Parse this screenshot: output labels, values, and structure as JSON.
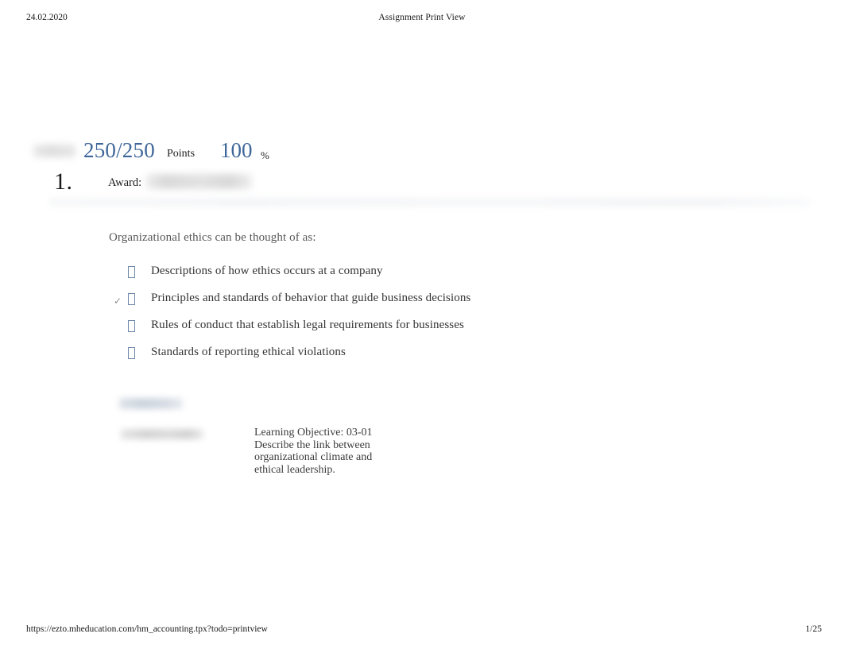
{
  "page": {
    "header": {
      "date": "24.02.2020",
      "title": "Assignment Print View"
    },
    "footer": {
      "url": "https://ezto.mheducation.com/hm_accounting.tpx?todo=printview",
      "page_number": "1/25"
    }
  },
  "score": {
    "label_redacted": "",
    "points_value": "250/250",
    "points_label": "Points",
    "percent_value": "100",
    "percent_sign": "%",
    "accent_color": "#3f6699"
  },
  "question": {
    "number": "1.",
    "award_label": "Award:",
    "award_value_redacted": "",
    "stem": "Organizational ethics can be thought of as:",
    "selected_marker": "✓",
    "options": [
      {
        "marker": "",
        "text": "Descriptions of how ethics occurs at a company",
        "selected": false
      },
      {
        "marker": "✓",
        "text": "Principles and standards of behavior that guide business decisions",
        "selected": true
      },
      {
        "marker": "",
        "text": "Rules of conduct that establish legal requirements for businesses",
        "selected": false
      },
      {
        "marker": "",
        "text": "Standards of reporting ethical violations",
        "selected": false
      }
    ]
  },
  "meta": {
    "references_redacted": "",
    "difficulty_redacted": "",
    "learning_objective": "Learning Objective: 03-01 Describe the link between organizational climate and ethical leadership."
  }
}
